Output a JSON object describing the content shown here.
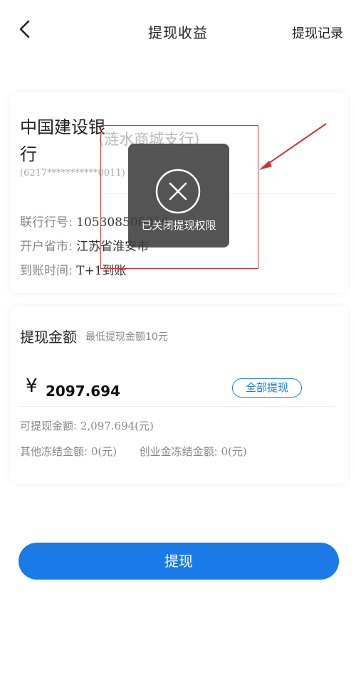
{
  "header": {
    "title": "提现收益",
    "record_link": "提现记录",
    "back_icon": "chevron-left-icon"
  },
  "bank_card": {
    "bank_name": "中国建设银行",
    "branch": "(涟水商城支行)",
    "card_number": "(6217***********0011)",
    "bank_code_label": "联行行号:",
    "bank_code_value": "105308500056",
    "province_label": "开户省市:",
    "province_value": "江苏省淮安市",
    "arrival_label": "到账时间:",
    "arrival_value": "T+1到账"
  },
  "amount_section": {
    "title": "提现金额",
    "min_hint": "最低提现金额10元",
    "currency_symbol": "¥",
    "amount_value": "2097.694",
    "withdraw_all_label": "全部提现",
    "available_label": "可提现金额:",
    "available_value": "2,097.694(元)",
    "other_frozen_label": "其他冻结金额:",
    "other_frozen_value": "0(元)",
    "venture_frozen_label": "创业金冻结金额:",
    "venture_frozen_value": "0(元)"
  },
  "submit": {
    "label": "提现"
  },
  "toast": {
    "message": "已关闭提现权限",
    "icon": "close-circle-icon"
  },
  "colors": {
    "accent": "#1a7ae8",
    "annotation": "#d23232",
    "toast_bg": "#3c3c3c"
  }
}
